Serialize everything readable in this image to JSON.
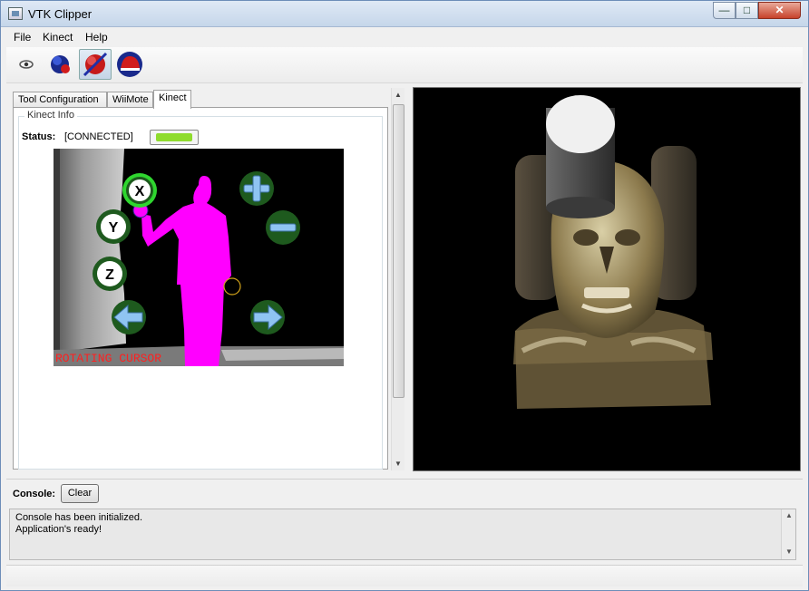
{
  "window": {
    "title": "VTK Clipper"
  },
  "menubar": {
    "items": [
      "File",
      "Kinect",
      "Help"
    ]
  },
  "toolbar": {
    "buttons": [
      {
        "icon": "eye-icon"
      },
      {
        "icon": "sphere-tool-icon"
      },
      {
        "icon": "clip-plane-icon",
        "active": true
      },
      {
        "icon": "cap-tool-icon"
      }
    ]
  },
  "tabs": [
    {
      "label": "Tool Configuration"
    },
    {
      "label": "WiiMote"
    },
    {
      "label": "Kinect",
      "selected": true
    }
  ],
  "kinect_info": {
    "group_title": "Kinect Info",
    "status_label": "Status:",
    "status_value": "[CONNECTED]",
    "overlay_text": "ROTATING CURSOR",
    "buttons": [
      {
        "label": "X",
        "type": "axis",
        "highlighted": true
      },
      {
        "label": "Y",
        "type": "axis"
      },
      {
        "label": "Z",
        "type": "axis"
      },
      {
        "label": "",
        "type": "plus"
      },
      {
        "label": "",
        "type": "minus"
      },
      {
        "label": "",
        "type": "left-arrow"
      },
      {
        "label": "",
        "type": "right-arrow"
      }
    ]
  },
  "console": {
    "label": "Console:",
    "clear_label": "Clear",
    "lines": [
      "Console has been initialized.",
      "Application's ready!"
    ]
  },
  "colors": {
    "user_silhouette": "#ff00ff",
    "axis_button_ring": "#1e5a1e",
    "highlight_ring": "#2fd62f",
    "overlay_text": "#ff2020",
    "clip_cylinder": "#4b4b4b"
  }
}
